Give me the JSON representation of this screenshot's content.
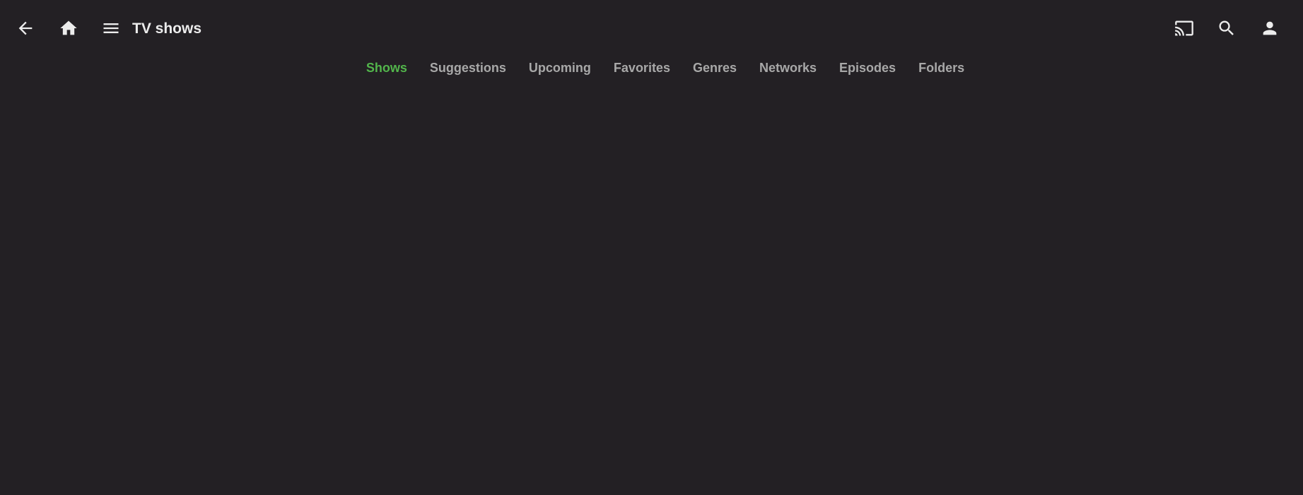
{
  "header": {
    "title": "TV shows",
    "icons": {
      "back": "arrow-back-icon",
      "home": "home-icon",
      "menu": "menu-icon",
      "cast": "cast-icon",
      "search": "search-icon",
      "user": "user-icon"
    }
  },
  "tabs": [
    {
      "label": "Shows",
      "active": true
    },
    {
      "label": "Suggestions",
      "active": false
    },
    {
      "label": "Upcoming",
      "active": false
    },
    {
      "label": "Favorites",
      "active": false
    },
    {
      "label": "Genres",
      "active": false
    },
    {
      "label": "Networks",
      "active": false
    },
    {
      "label": "Episodes",
      "active": false
    },
    {
      "label": "Folders",
      "active": false
    }
  ],
  "colors": {
    "background": "#232024",
    "accent": "#52b54b",
    "tab_inactive": "#a8a8a8",
    "text": "#ececec"
  }
}
